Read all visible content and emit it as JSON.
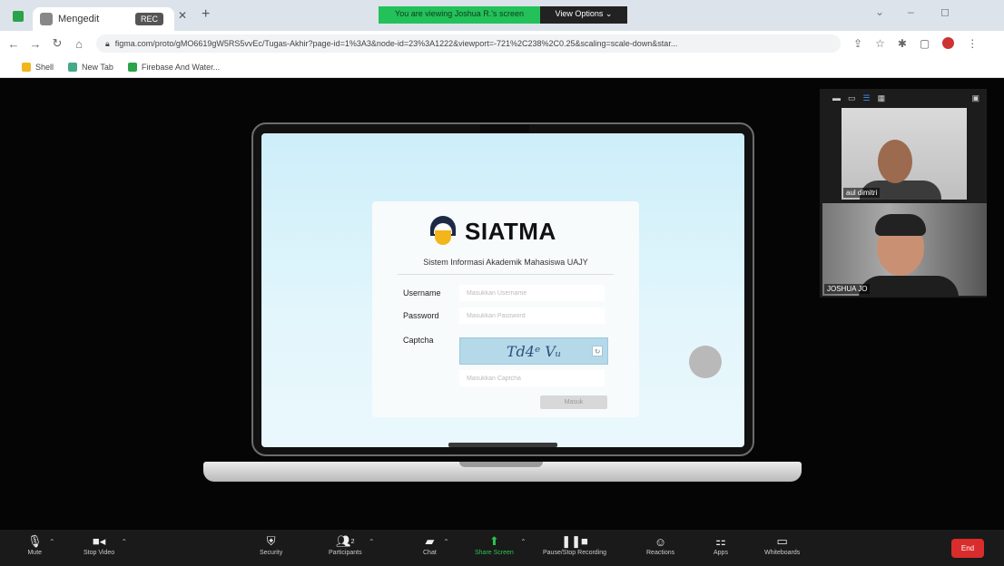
{
  "browser": {
    "tab_title": "Mengedit",
    "tab_badge": "REC",
    "share_banner": "You are viewing Joshua R.'s screen",
    "view_options": "View Options ⌄",
    "url": "figma.com/proto/gMO6619gW5RS5vvEc/Tugas-Akhir?page-id=1%3A3&node-id=23%3A1222&viewport=-721%2C238%2C0.25&scaling=scale-down&star...",
    "bookmarks": [
      "Shell",
      "New Tab",
      "Firebase And Water..."
    ]
  },
  "app": {
    "brand": "SIATMA",
    "subtitle": "Sistem Informasi Akademik Mahasiswa UAJY",
    "username_label": "Username",
    "username_placeholder": "Masukkan Username",
    "password_label": "Password",
    "password_placeholder": "Masukkan Password",
    "captcha_label": "Captcha",
    "captcha_text": "Td4ᵉ Vᵤ",
    "captcha_placeholder": "Masukkan Captcha",
    "login_button": "Masuk"
  },
  "participants": [
    {
      "name": "aul dimitri"
    },
    {
      "name": "JOSHUA JO"
    }
  ],
  "zoom_toolbar": {
    "mute": "Mute",
    "stop_video": "Stop Video",
    "security": "Security",
    "participants": "Participants",
    "participants_count": "2",
    "chat": "Chat",
    "share_screen": "Share Screen",
    "recording": "Pause/Stop Recording",
    "reactions": "Reactions",
    "apps": "Apps",
    "whiteboards": "Whiteboards",
    "end": "End"
  }
}
